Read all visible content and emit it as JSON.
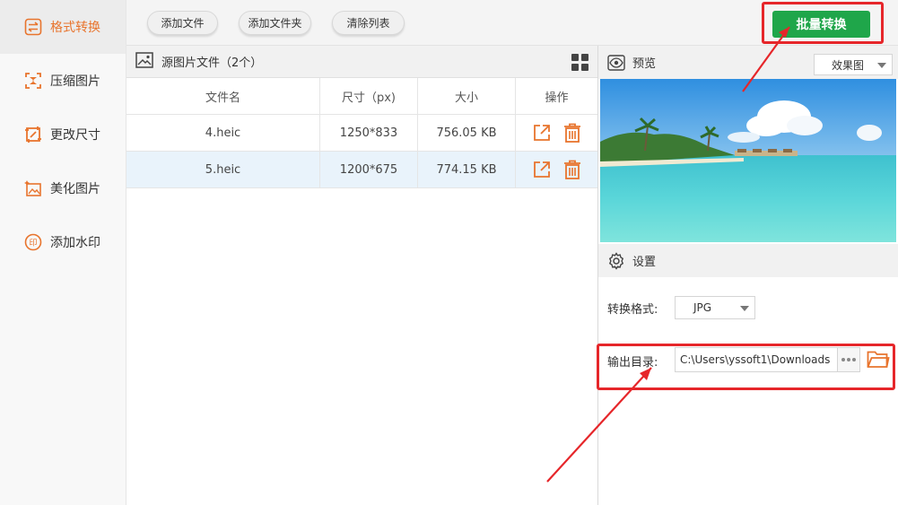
{
  "sidebar": {
    "items": [
      {
        "label": "格式转换",
        "icon": "swap-arrows-icon",
        "active": true
      },
      {
        "label": "压缩图片",
        "icon": "compress-icon",
        "active": false
      },
      {
        "label": "更改尺寸",
        "icon": "resize-icon",
        "active": false
      },
      {
        "label": "美化图片",
        "icon": "beautify-icon",
        "active": false
      },
      {
        "label": "添加水印",
        "icon": "watermark-icon",
        "active": false
      }
    ]
  },
  "toolbar": {
    "add_file": "添加文件",
    "add_folder": "添加文件夹",
    "clear_list": "清除列表",
    "batch_convert": "批量转换"
  },
  "file_panel": {
    "title": "源图片文件（2个）",
    "columns": [
      "文件名",
      "尺寸（px)",
      "大小",
      "操作"
    ],
    "rows": [
      {
        "name": "4.heic",
        "dimensions": "1250*833",
        "size": "756.05 KB",
        "selected": false
      },
      {
        "name": "5.heic",
        "dimensions": "1200*675",
        "size": "774.15 KB",
        "selected": true
      }
    ]
  },
  "preview": {
    "label": "预览",
    "mode": "效果图"
  },
  "settings": {
    "label": "设置",
    "format_label": "转换格式:",
    "format_value": "JPG",
    "output_label": "输出目录:",
    "output_path": "C:\\Users\\yssoft1\\Downloads"
  },
  "colors": {
    "accent": "#e8742d",
    "convert_button": "#1fa64a",
    "highlight_box": "#e6262a",
    "selected_row": "#e9f3fb"
  }
}
